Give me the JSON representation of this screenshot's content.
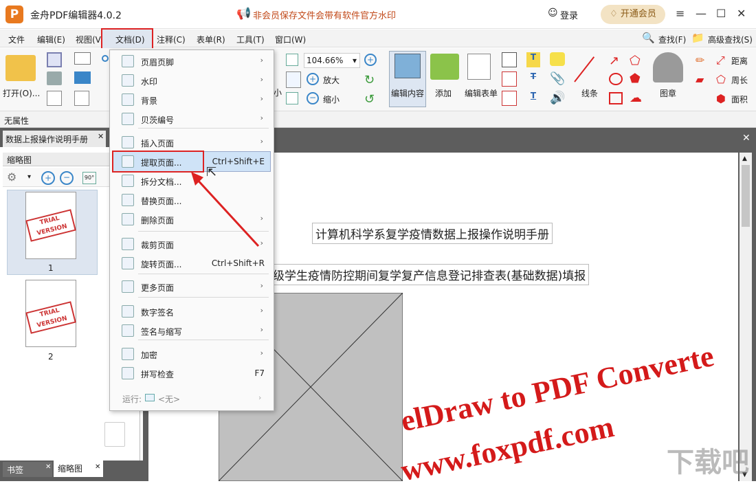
{
  "app": {
    "title": "金舟PDF编辑器4.0.2",
    "notice": "非会员保存文件会带有软件官方水印",
    "login": "登录",
    "vip": "开通会员",
    "logo": "P"
  },
  "menubar": {
    "file": "文件",
    "edit": "编辑(E)",
    "view": "视图(V)",
    "doc": "文档(D)",
    "annot": "注释(C)",
    "form": "表单(R)",
    "tools": "工具(T)",
    "window": "窗口(W)",
    "find": "查找(F)",
    "advfind": "高级查找(S)"
  },
  "ribbon": {
    "open": "打开(O)...",
    "zoom": "104.66%",
    "zoomin": "放大",
    "zoomout": "缩小",
    "small": "小",
    "edit_content": "编辑内容",
    "add": "添加",
    "edit_form": "编辑表单",
    "line": "线条",
    "stamp": "图章",
    "distance": "距离",
    "perimeter": "周长",
    "area": "面积"
  },
  "props": {
    "label": "无属性"
  },
  "tabs": {
    "doc": "数据上报操作说明手册"
  },
  "panel": {
    "title": "缩略图",
    "page1": "1",
    "page2": "2",
    "bookmark": "书签",
    "thumbs": "缩略图"
  },
  "doc": {
    "line1": "计算机科学系复学疫情数据上报操作说明手册",
    "line2": "级学生疫情防控期间复学复产信息登记排查表(基础数据)填报",
    "watermark1": "elDraw to PDF Converte",
    "watermark2": "www.foxpdf.com"
  },
  "menu": {
    "items": [
      {
        "label": "页眉页脚",
        "arrow": "›"
      },
      {
        "label": "水印",
        "arrow": "›"
      },
      {
        "label": "背景",
        "arrow": "›"
      },
      {
        "label": "贝茨编号",
        "arrow": "›"
      },
      {
        "label": "插入页面",
        "arrow": "›"
      },
      {
        "label": "提取页面...",
        "shortcut": "Ctrl+Shift+E"
      },
      {
        "label": "拆分文档..."
      },
      {
        "label": "替换页面..."
      },
      {
        "label": "删除页面",
        "arrow": "›"
      },
      {
        "label": "裁剪页面",
        "arrow": "›"
      },
      {
        "label": "旋转页面...",
        "shortcut": "Ctrl+Shift+R"
      },
      {
        "label": "更多页面",
        "arrow": "›"
      },
      {
        "label": "数字签名",
        "arrow": "›"
      },
      {
        "label": "签名与缩写",
        "arrow": "›"
      },
      {
        "label": "加密",
        "arrow": "›"
      },
      {
        "label": "拼写检查",
        "shortcut": "F7"
      }
    ],
    "run": "运行:",
    "run_value": "<无>"
  },
  "watermark_site": "下载吧"
}
